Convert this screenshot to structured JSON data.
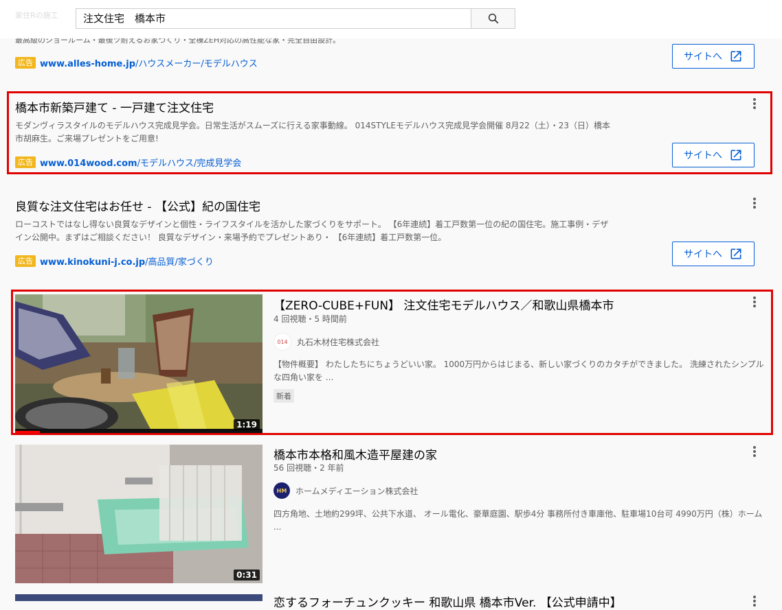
{
  "search": {
    "query": "注文住宅　橋本市",
    "button_icon": "search-icon"
  },
  "peek": {
    "left_fragment": "家住Rの施工",
    "description_fragment": "最高級のショールーム・最後ツ耐えるお家づくり・全棟ZEH対応の高性能な家・完全自由設計。"
  },
  "ads": [
    {
      "title": "",
      "description": "",
      "badge": "広告",
      "url_domain": "www.alles-home.jp",
      "url_path": "/ハウスメーカー/モデルハウス",
      "button_label": "サイトへ"
    },
    {
      "title": "橋本市新築戸建て - 一戸建て注文住宅",
      "description": "モダンヴィラスタイルのモデルハウス完成見学会。日常生活がスムーズに行える家事動線。 014STYLEモデルハウス完成見学会開催 8月22（土）・23（日）橋本市胡麻生。ご来場プレゼントをご用意!",
      "badge": "広告",
      "url_domain": "www.014wood.com",
      "url_path": "/モデルハウス/完成見学会",
      "button_label": "サイトへ"
    },
    {
      "title": "良質な注文住宅はお任せ - 【公式】紀の国住宅",
      "description": "ローコストではなし得ない良質なデザインと個性・ライフスタイルを活かした家づくりをサポート。 【6年連続】着工戸数第一位の紀の国住宅。施工事例・デザイン公開中。まずはご相談ください！ 良質なデザイン・来場予約でプレゼントあり・ 【6年連続】着工戸数第一位。",
      "badge": "広告",
      "url_domain": "www.kinokuni-j.co.jp",
      "url_path": "/高品質/家づくり",
      "button_label": "サイトへ"
    }
  ],
  "videos": [
    {
      "title": "【ZERO-CUBE+FUN】 注文住宅モデルハウス／和歌山県橋本市",
      "meta": "4 回視聴・5 時間前",
      "channel": "丸石木材住宅株式会社",
      "avatar_text": "014",
      "description": "【物件概要】 わたしたちにちょうどいい家。 1000万円からはじまる、新しい家づくりのカタチができました。 洗練されたシンプルな四角い家を ...",
      "badge": "新着",
      "duration": "1:19",
      "watch_progress": 0.1
    },
    {
      "title": "橋本市本格和風木造平屋建の家",
      "meta": "56 回視聴・2 年前",
      "channel": "ホームメディエーション株式会社",
      "avatar_text": "HM",
      "description": "四方角地、土地約299坪、公共下水道、 オール電化、豪華庭園、駅歩4分 事務所付き車庫他、駐車場10台可 4990万円（株）ホーム ...",
      "duration": "0:31"
    },
    {
      "title": "恋するフォーチュンクッキー 和歌山県 橋本市Ver. 【公式申請中】"
    }
  ],
  "colors": {
    "link_blue": "#065fd4",
    "ad_badge": "#f2b71e",
    "highlight_red": "#e00000",
    "background": "#f9f9f9"
  }
}
